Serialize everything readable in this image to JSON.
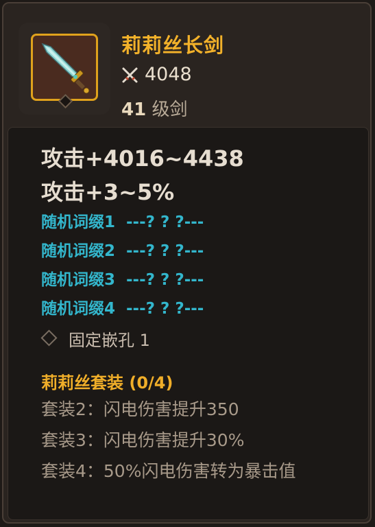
{
  "item": {
    "name": "莉莉丝长剑",
    "power": "4048",
    "level": "41",
    "type": "级剑",
    "icon": "sword-icon",
    "power_icon": "crossed-swords-icon"
  },
  "stats": {
    "attack_flat": "攻击+4016~4438",
    "attack_pct": "攻击+3~5%"
  },
  "affixes": [
    {
      "label": "随机词缀1",
      "value": "---? ? ?---"
    },
    {
      "label": "随机词缀2",
      "value": "---? ? ?---"
    },
    {
      "label": "随机词缀3",
      "value": "---? ? ?---"
    },
    {
      "label": "随机词缀4",
      "value": "---? ? ?---"
    }
  ],
  "socket": {
    "label": "固定嵌孔 1"
  },
  "set": {
    "title": "莉莉丝套装 (0/4)",
    "bonuses": [
      "套装2：闪电伤害提升350",
      "套装3：闪电伤害提升30%",
      "套装4：50%闪电伤害转为暴击值"
    ]
  },
  "colors": {
    "name_gold": "#f2b12a",
    "affix_cyan": "#33b6cc",
    "set_bonus_gray": "#a89a8a",
    "frame_gold": "#e0a21c"
  }
}
